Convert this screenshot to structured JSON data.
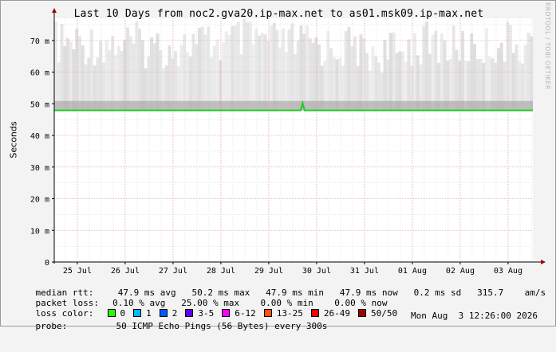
{
  "title": "Last 10 Days from noc2.gva20.ip-max.net to as01.msk09.ip-max.net",
  "watermark": "RRDTOOL / TOBI OETIKER",
  "colors": {
    "median": "#22cc22",
    "smoke": "#bdbdbd",
    "grid_major": "#e7a3a3",
    "grid_minor": "#dddddd",
    "axis": "#000000"
  },
  "chart_data": {
    "type": "area",
    "ylabel": "Seconds",
    "y_unit": "m",
    "ylim": [
      0,
      77
    ],
    "yticks": [
      0,
      10,
      20,
      30,
      40,
      50,
      60,
      70
    ],
    "ytick_labels": [
      "0",
      "10 m",
      "20 m",
      "30 m",
      "40 m",
      "50 m",
      "60 m",
      "70 m"
    ],
    "x_range": [
      "2026-07-24 12:26",
      "2026-08-03 12:26"
    ],
    "xticks": [
      "2026-07-25",
      "2026-07-26",
      "2026-07-27",
      "2026-07-28",
      "2026-07-29",
      "2026-07-30",
      "2026-07-31",
      "2026-08-01",
      "2026-08-02",
      "2026-08-03"
    ],
    "xtick_labels": [
      "25 Jul",
      "26 Jul",
      "27 Jul",
      "28 Jul",
      "29 Jul",
      "30 Jul",
      "31 Jul",
      "01 Aug",
      "02 Aug",
      "03 Aug"
    ],
    "series": [
      {
        "name": "median rtt",
        "x": [
          "2026-07-24 12:26",
          "2026-07-25 12:00",
          "2026-07-26 12:00",
          "2026-07-27 12:00",
          "2026-07-28 12:00",
          "2026-07-29 12:00",
          "2026-07-29 16:00",
          "2026-07-29 17:00",
          "2026-07-29 18:00",
          "2026-07-30 12:00",
          "2026-07-31 12:00",
          "2026-08-01 12:00",
          "2026-08-02 12:00",
          "2026-08-03 12:26"
        ],
        "values": [
          47.9,
          47.9,
          47.9,
          47.9,
          47.9,
          47.9,
          47.9,
          50.2,
          47.9,
          47.9,
          47.9,
          47.9,
          47.9,
          47.9
        ]
      }
    ],
    "smoke": {
      "x": [
        "2026-07-24 12:26",
        "2026-07-25 00:00",
        "2026-07-26 00:00",
        "2026-07-27 00:00",
        "2026-07-28 00:00",
        "2026-07-29 00:00",
        "2026-07-30 00:00",
        "2026-07-31 00:00",
        "2026-08-01 00:00",
        "2026-08-02 00:00",
        "2026-08-03 00:00",
        "2026-08-03 12:26"
      ],
      "max": [
        76,
        76,
        75,
        76,
        77,
        76,
        75,
        73,
        76,
        75,
        76,
        76
      ]
    }
  },
  "legend": {
    "median_label": "median rtt:",
    "median_values": "  47.9 ms avg   50.2 ms max   47.9 ms min   47.9 ms now   0.2 ms sd   315.7    am/s",
    "loss_label": "packet loss:",
    "loss_values": " 0.10 % avg   25.00 % max    0.00 % min    0.00 % now",
    "color_label": "loss color:",
    "loss_colors": [
      {
        "label": "0",
        "color": "#26ff00"
      },
      {
        "label": "1",
        "color": "#00b8ff"
      },
      {
        "label": "2",
        "color": "#0059ff"
      },
      {
        "label": "3-5",
        "color": "#5e00ff"
      },
      {
        "label": "6-12",
        "color": "#ff00ff"
      },
      {
        "label": "13-25",
        "color": "#ff5500"
      },
      {
        "label": "26-49",
        "color": "#ff0000"
      },
      {
        "label": "50/50",
        "color": "#a10000"
      }
    ],
    "probe_label": "probe:",
    "probe_value": "        50 ICMP Echo Pings (56 Bytes) every 300s",
    "date": "Mon Aug  3 12:26:00 2026"
  }
}
